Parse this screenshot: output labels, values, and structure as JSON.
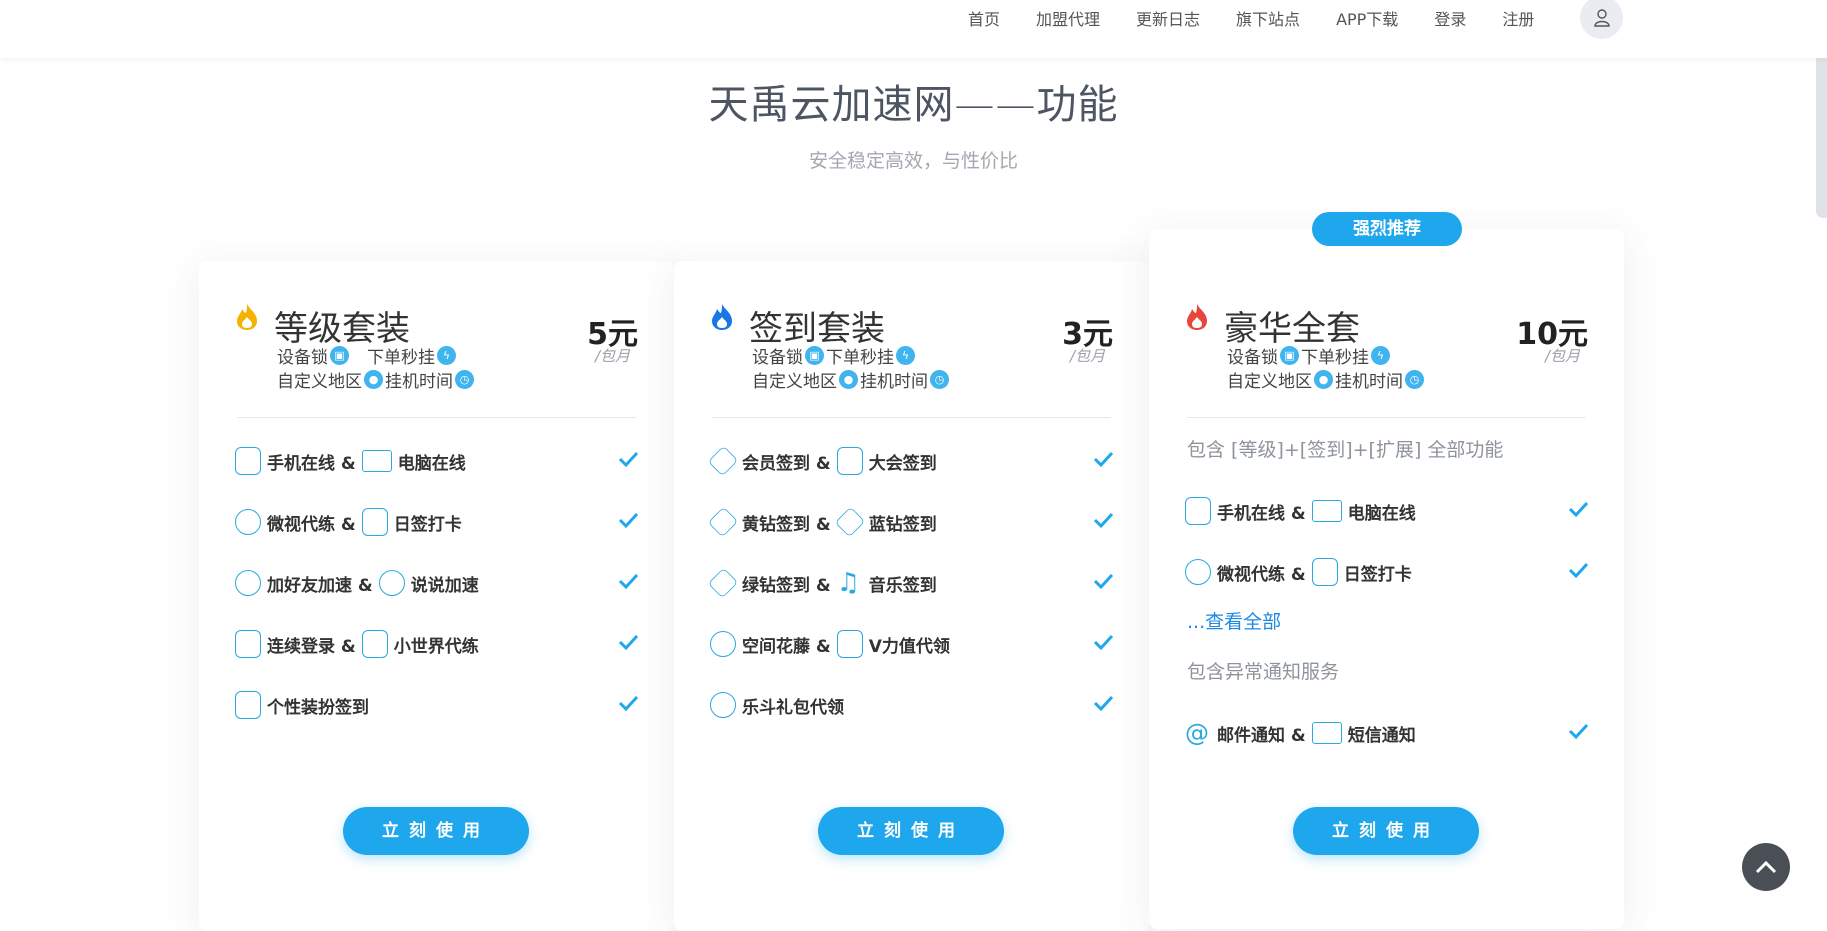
{
  "nav": {
    "items": [
      "首页",
      "加盟代理",
      "更新日志",
      "旗下站点",
      "APP下载",
      "登录",
      "注册"
    ]
  },
  "section": {
    "title": "天禹云加速网——功能",
    "subtitle": "安全稳定高效，与性价比"
  },
  "colors": {
    "accent": "#1ea7ec",
    "flame_yellow": "#f5b301",
    "flame_blue": "#1877e6",
    "flame_red": "#e8453c",
    "link": "#1e88e5"
  },
  "plans": [
    {
      "name": "等级套装",
      "price": "5元",
      "period": "/包月",
      "feature_line1": [
        "设备锁",
        "下单秒挂"
      ],
      "feature_line2": [
        "自定义地区",
        "挂机时间"
      ],
      "items": [
        {
          "a": "手机在线 &",
          "b": "电脑在线"
        },
        {
          "a": "微视代练 &",
          "b": "日签打卡"
        },
        {
          "a": "加好友加速 &",
          "b": "说说加速"
        },
        {
          "a": "连续登录 &",
          "b": "小世界代练"
        },
        {
          "a": "个性装扮签到",
          "b": ""
        }
      ],
      "button": "立刻使用"
    },
    {
      "name": "签到套装",
      "price": "3元",
      "period": "/包月",
      "feature_line1": [
        "设备锁",
        "下单秒挂"
      ],
      "feature_line2": [
        "自定义地区",
        "挂机时间"
      ],
      "items": [
        {
          "a": "会员签到 &",
          "b": "大会签到"
        },
        {
          "a": "黄钻签到 &",
          "b": "蓝钻签到"
        },
        {
          "a": "绿钻签到 &",
          "b": "音乐签到"
        },
        {
          "a": "空间花藤 &",
          "b": "V力值代领"
        },
        {
          "a": "乐斗礼包代领",
          "b": ""
        }
      ],
      "button": "立刻使用"
    },
    {
      "badge": "强烈推荐",
      "name": "豪华全套",
      "price": "10元",
      "period": "/包月",
      "feature_line1": [
        "设备锁",
        "下单秒挂"
      ],
      "feature_line2": [
        "自定义地区",
        "挂机时间"
      ],
      "includes": "包含 [等级]+[签到]+[扩展] 全部功能",
      "items": [
        {
          "a": "手机在线 &",
          "b": "电脑在线"
        },
        {
          "a": "微视代练 &",
          "b": "日签打卡"
        }
      ],
      "more_link": "...查看全部",
      "notify_title": "包含异常通知服务",
      "notify_item": {
        "a": "邮件通知 &",
        "b": "短信通知"
      },
      "button": "立刻使用"
    }
  ]
}
